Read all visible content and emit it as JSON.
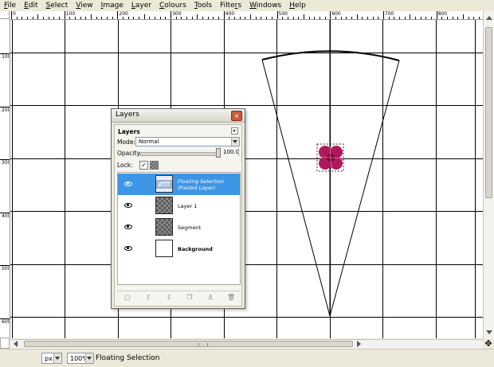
{
  "menubar": {
    "items": [
      {
        "label": "File",
        "u": "F",
        "rest": "ile"
      },
      {
        "label": "Edit",
        "u": "E",
        "rest": "dit"
      },
      {
        "label": "Select",
        "u": "S",
        "rest": "elect"
      },
      {
        "label": "View",
        "u": "V",
        "rest": "iew"
      },
      {
        "label": "Image",
        "u": "I",
        "rest": "mage"
      },
      {
        "label": "Layer",
        "u": "L",
        "rest": "ayer"
      },
      {
        "label": "Colours",
        "u": "C",
        "rest": "olours"
      },
      {
        "label": "Tools",
        "u": "T",
        "rest": "ools"
      },
      {
        "label": "Filters",
        "pre": "Filte",
        "u": "r",
        "rest": "s"
      },
      {
        "label": "Windows",
        "u": "W",
        "rest": "indows"
      },
      {
        "label": "Help",
        "u": "H",
        "rest": "elp"
      }
    ]
  },
  "rulers": {
    "top": [
      "0",
      "100",
      "200",
      "300",
      "400",
      "500",
      "600",
      "700",
      "800"
    ],
    "left": [
      "100",
      "200",
      "300",
      "400",
      "500",
      "600"
    ]
  },
  "layers_dialog": {
    "title": "Layers",
    "close_glyph": "×",
    "dock_title": "Layers",
    "mode_label": "Mode:",
    "mode_value": "Normal",
    "opacity_label": "Opacity:",
    "opacity_value": "100.0",
    "opacity": 1.0,
    "lock_label": "Lock:",
    "lock_pixels_glyph": "✓",
    "layers": [
      {
        "name": "Floating Selection",
        "subname": "(Pasted Layer)",
        "selected": true,
        "thumb": "floating",
        "style": "italic"
      },
      {
        "name": "Layer 1",
        "subname": "",
        "selected": false,
        "thumb": "checker",
        "style": "normal"
      },
      {
        "name": "Segment",
        "subname": "",
        "selected": false,
        "thumb": "checker",
        "style": "normal"
      },
      {
        "name": "Background",
        "subname": "",
        "selected": false,
        "thumb": "white",
        "style": "bold"
      }
    ],
    "buttons": [
      {
        "icon": "new-layer-icon",
        "glyph": "▢"
      },
      {
        "icon": "raise-layer-icon",
        "glyph": "⇧"
      },
      {
        "icon": "lower-layer-icon",
        "glyph": "⇩"
      },
      {
        "icon": "duplicate-layer-icon",
        "glyph": "❐"
      },
      {
        "icon": "anchor-layer-icon",
        "glyph": "⚓"
      },
      {
        "icon": "delete-layer-icon",
        "glyph": "🗑"
      }
    ]
  },
  "statusbar": {
    "unit": "px",
    "zoom": "100%",
    "message": "Floating Selection"
  },
  "colors": {
    "selection": "#3d95e6",
    "flower": "#b0185e",
    "flower_center": "#6a0a33",
    "grid": "#000000"
  }
}
